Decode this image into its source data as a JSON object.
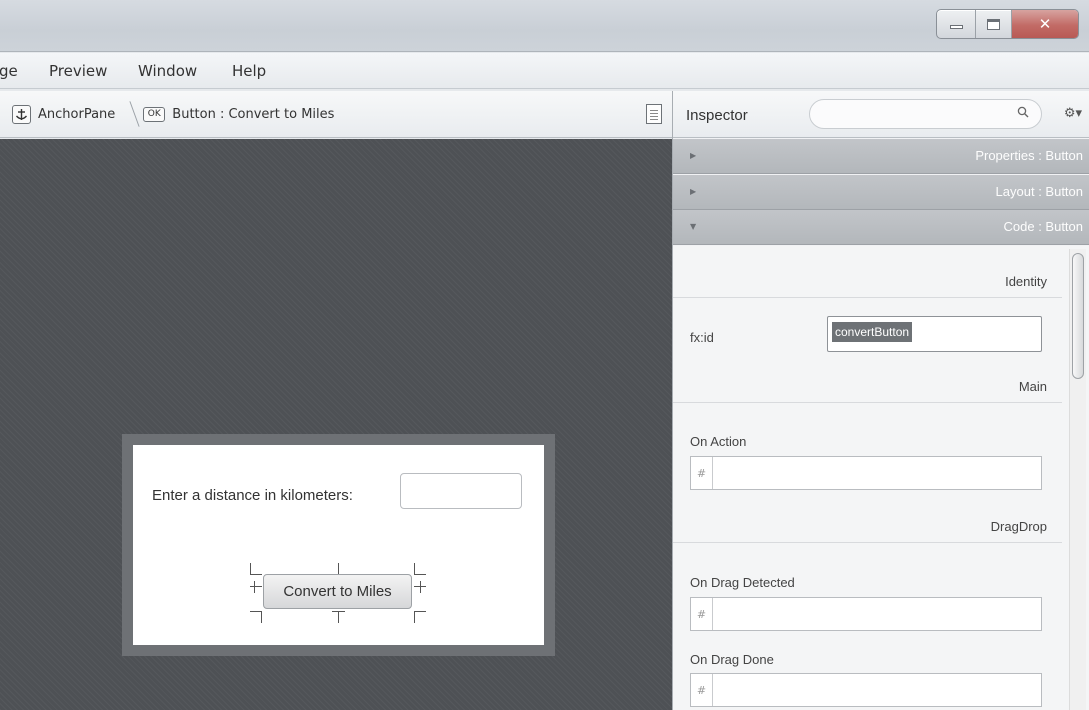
{
  "menubar": {
    "items": [
      "ge",
      "Preview",
      "Window",
      "Help"
    ]
  },
  "breadcrumb": {
    "root": "AnchorPane",
    "ok_badge": "OK",
    "current": "Button : Convert to Miles"
  },
  "stage": {
    "label": "Enter a distance in kilometers:",
    "button": "Convert to Miles"
  },
  "inspector": {
    "title": "Inspector",
    "sections": [
      {
        "label": "Properties : Button",
        "expanded": false
      },
      {
        "label": "Layout : Button",
        "expanded": false
      },
      {
        "label": "Code : Button",
        "expanded": true
      }
    ],
    "identity_header": "Identity",
    "fxid_label": "fx:id",
    "fxid_value": "convertButton",
    "main_header": "Main",
    "on_action_label": "On Action",
    "dragdrop_header": "DragDrop",
    "on_drag_detected_label": "On Drag Detected",
    "on_drag_done_label": "On Drag Done",
    "hash_symbol": "#"
  },
  "icons": {
    "anchor": "anchor-icon",
    "document": "document-icon",
    "search": "search-icon",
    "gear": "gear-icon"
  }
}
